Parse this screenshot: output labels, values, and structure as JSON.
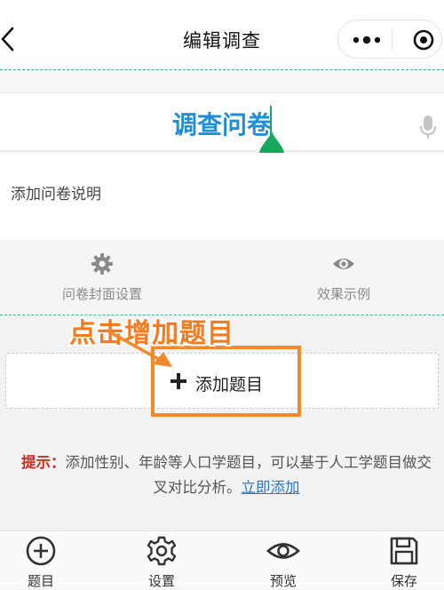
{
  "nav": {
    "title": "编辑调查"
  },
  "survey": {
    "title": "调查问卷",
    "description_placeholder": "添加问卷说明"
  },
  "settings": {
    "cover_label": "问卷封面设置",
    "preview_label": "效果示例"
  },
  "annotation": {
    "text": "点击增加题目"
  },
  "add_question": {
    "label": "添加题目"
  },
  "tip": {
    "label": "提示：",
    "text": "添加性别、年龄等人口学题目，可以基于人工学题目做交叉对比分析。",
    "link": "立即添加"
  },
  "tabs": [
    {
      "label": "题目",
      "icon": "plus-circle-icon"
    },
    {
      "label": "设置",
      "icon": "gear-icon"
    },
    {
      "label": "预览",
      "icon": "eye-icon"
    },
    {
      "label": "保存",
      "icon": "save-icon"
    }
  ],
  "colors": {
    "title_blue": "#1f8ed8",
    "annotation_orange": "#f47b20",
    "tip_red": "#d42a1e",
    "link_blue": "#2a78c6",
    "cursor_green": "#17a85c",
    "dashed_teal": "#3bb0a5"
  }
}
